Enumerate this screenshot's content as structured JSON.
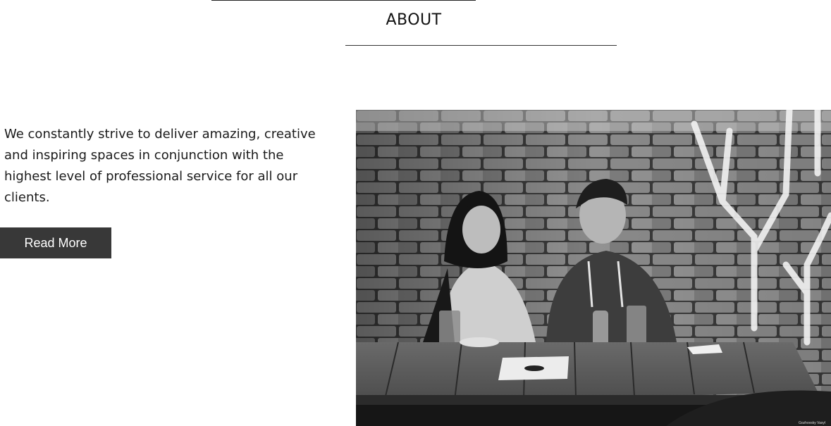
{
  "section": {
    "title": "ABOUT"
  },
  "about": {
    "text": "We constantly strive to deliver amazing, creative and inspiring spaces in conjunction with the highest level of professional service for all our clients.",
    "button_label": "Read More"
  },
  "photo": {
    "credit": "Gozhovsky Vasyl",
    "style": "black-and-white"
  },
  "colors": {
    "button_bg": "#383838",
    "button_text": "#ffffff",
    "text": "#1a1a1a",
    "rule": "#333333"
  }
}
